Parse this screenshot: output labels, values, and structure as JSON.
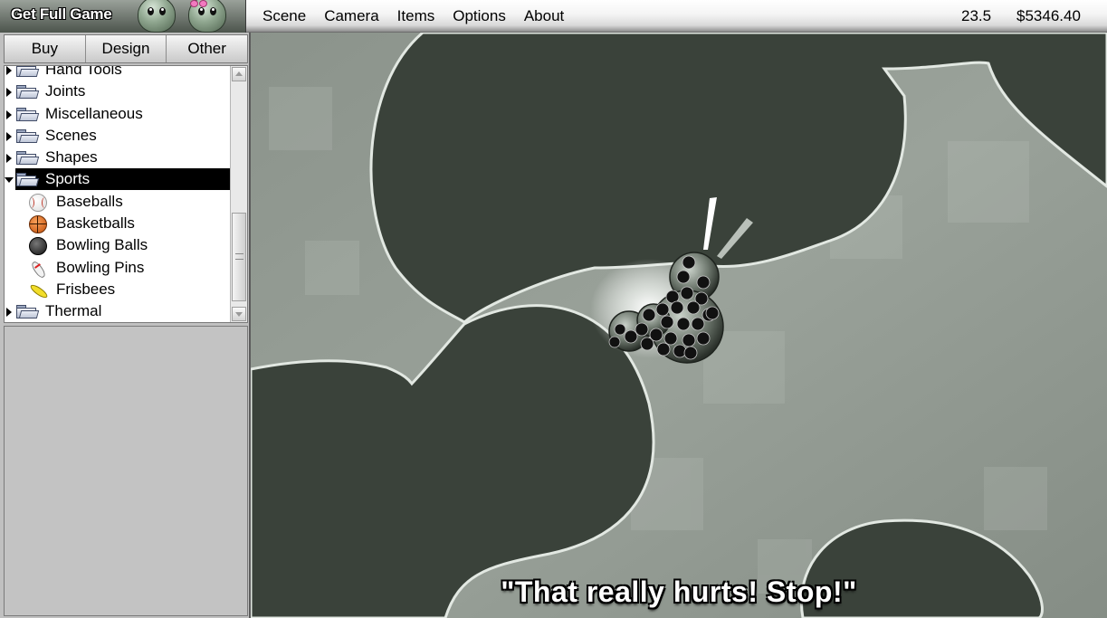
{
  "topbar": {
    "get_full_game_label": "Get Full Game",
    "menu": [
      "Scene",
      "Camera",
      "Items",
      "Options",
      "About"
    ],
    "time_value": "23.5",
    "money_value": "$5346.40"
  },
  "tabs": [
    "Buy",
    "Design",
    "Other"
  ],
  "tree": {
    "categories_before": [
      "Hand Tools",
      "Joints",
      "Miscellaneous",
      "Scenes",
      "Shapes"
    ],
    "selected_category": "Sports",
    "sports_items": [
      {
        "label": "Baseballs",
        "icon": "baseball-icon"
      },
      {
        "label": "Basketballs",
        "icon": "basketball-icon"
      },
      {
        "label": "Bowling Balls",
        "icon": "bowling-ball-icon"
      },
      {
        "label": "Bowling Pins",
        "icon": "bowling-pin-icon"
      },
      {
        "label": "Frisbees",
        "icon": "frisbee-icon"
      }
    ],
    "categories_after": [
      "Thermal"
    ]
  },
  "subtitle": "\"That really hurts! Stop!\"",
  "colors": {
    "background_wall": "#8e978e",
    "dark_blob": "#3a423a",
    "selected_row": "#000000"
  }
}
